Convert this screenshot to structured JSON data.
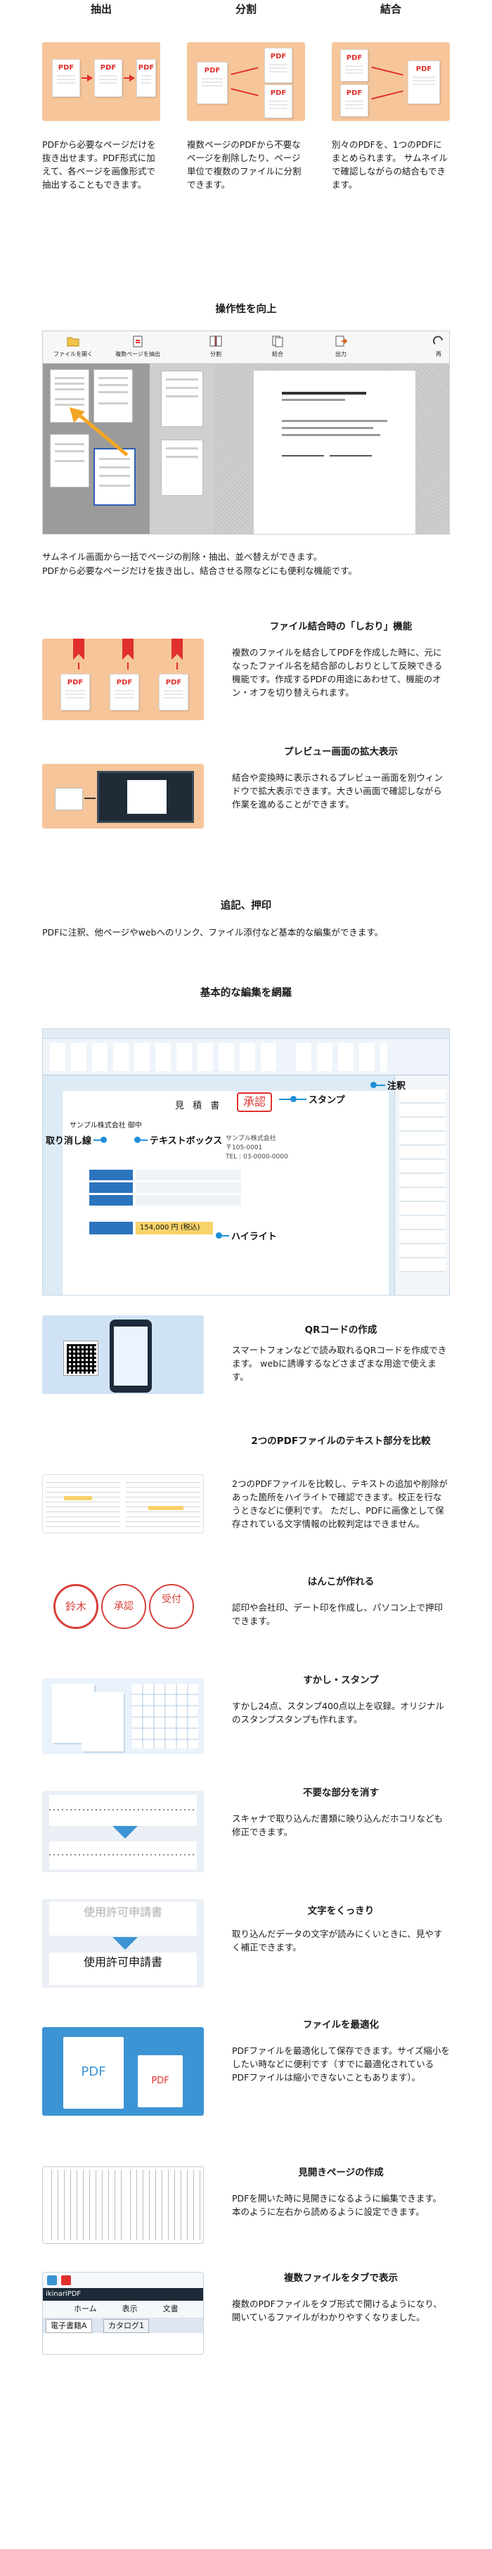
{
  "top_features": [
    {
      "title": "抽出",
      "description": "PDFから必要なページだけを抜き出せます。PDF形式に加えて、各ページを画像形式で抽出することもできます。"
    },
    {
      "title": "分割",
      "description": "複数ページのPDFから不要なページを削除したり、ページ単位で複数のファイルに分割できます。"
    },
    {
      "title": "結合",
      "description": "別々のPDFを、1つのPDFにまとめられます。 サムネイルで確認しながらの結合もできます。"
    }
  ],
  "pdf_label": "PDF",
  "operability": {
    "title": "操作性を向上",
    "toolbar": [
      "ファイルを開く",
      "複数ページを抽出",
      "分割",
      "結合",
      "出力",
      "再"
    ],
    "description": "サムネイル画面から一括でページの削除・抽出、並べ替えができます。\nPDFから必要なページだけを抜き出し、結合させる際などにも便利な機能です。"
  },
  "bookmark": {
    "title": "ファイル結合時の「しおり」機能",
    "description": "複数のファイルを結合してPDFを作成した時に、元になったファイル名を結合部のしおりとして反映できる機能です。作成するPDFの用途にあわせて、機能のオン・オフを切り替えられます。"
  },
  "preview": {
    "title": "プレビュー画面の拡大表示",
    "description": "結合や変換時に表示されるプレビュー画面を別ウィンドウで拡大表示できます。大きい画面で確認しながら作業を進めることができます。"
  },
  "annotate": {
    "title": "追記、押印",
    "description": "PDFに注釈、他ページやwebへのリンク、ファイル添付など基本的な編集ができます。"
  },
  "basic_edit": {
    "title": "基本的な編集を網羅",
    "callouts": {
      "stamp": "スタンプ",
      "note": "注釈",
      "strike": "取り消し線",
      "textbox": "テキストボックス",
      "highlight": "ハイライト"
    },
    "doc": {
      "heading": "見 積 書",
      "recipient": "サンプル株式会社 御中",
      "stamp_text": "承認",
      "amount": "154,000 円 (税込)",
      "company": "サンプル株式会社",
      "address": "〒105-0001",
      "tel": "TEL : 03-0000-0000"
    }
  },
  "features": [
    {
      "key": "qr",
      "title": "QRコードの作成",
      "description": "スマートフォンなどで読み取れるQRコードを作成できます。 webに誘導するなどさまざまな用途で使えます。"
    },
    {
      "key": "compare",
      "title": "2つのPDFファイルのテキスト部分を比較",
      "description": "2つのPDFファイルを比較し、テキストの追加や削除があった箇所をハイライトで確認できます。校正を行なうときなどに便利です。 ただし、PDFに画像として保存されている文字情報の比較判定はできません。"
    },
    {
      "key": "seal",
      "title": "はんこが作れる",
      "description": "認印や会社印、デート印を作成し、パソコン上で押印できます。"
    },
    {
      "key": "stamp",
      "title": "すかし・スタンプ",
      "description": "すかし24点、スタンプ400点以上を収録。オリジナルのスタンプスタンプも作れます。"
    },
    {
      "key": "erase",
      "title": "不要な部分を消す",
      "description": "スキャナで取り込んだ書類に映り込んだホコリなども修正できます。"
    },
    {
      "key": "sharpen",
      "title": "文字をくっきり",
      "description": "取り込んだデータの文字が読みにくいときに、見やすく補正できます。"
    },
    {
      "key": "optimize",
      "title": "ファイルを最適化",
      "description": "PDFファイルを最適化して保存できます。サイズ縮小をしたい時などに便利です（すでに最適化されているPDFファイルは縮小できないこともあります）。"
    },
    {
      "key": "spread",
      "title": "見開きページの作成",
      "description": "PDFを開いた時に見開きになるように編集できます。本のように左右から読めるように設定できます。"
    },
    {
      "key": "tabs",
      "title": "複数ファイルをタブで表示",
      "description": "複数のPDFファイルをタブ形式で開けるようになり、開いているファイルがわかりやすくなりました。"
    }
  ],
  "seal_texts": {
    "left": "鈴木",
    "mid": "承認",
    "right": "受付"
  },
  "form_title": "使用許可申請書",
  "tabs_ui": {
    "tabs": [
      "ホーム",
      "表示",
      "文書"
    ],
    "file_tab": "電子書籍A",
    "catalog_tab": "カタログ1",
    "app": "ikinariPDF"
  },
  "colors": {
    "accent_orange": "#f6c69a",
    "pdf_red": "#e0302c",
    "edit_blue": "#1d8fd6"
  }
}
